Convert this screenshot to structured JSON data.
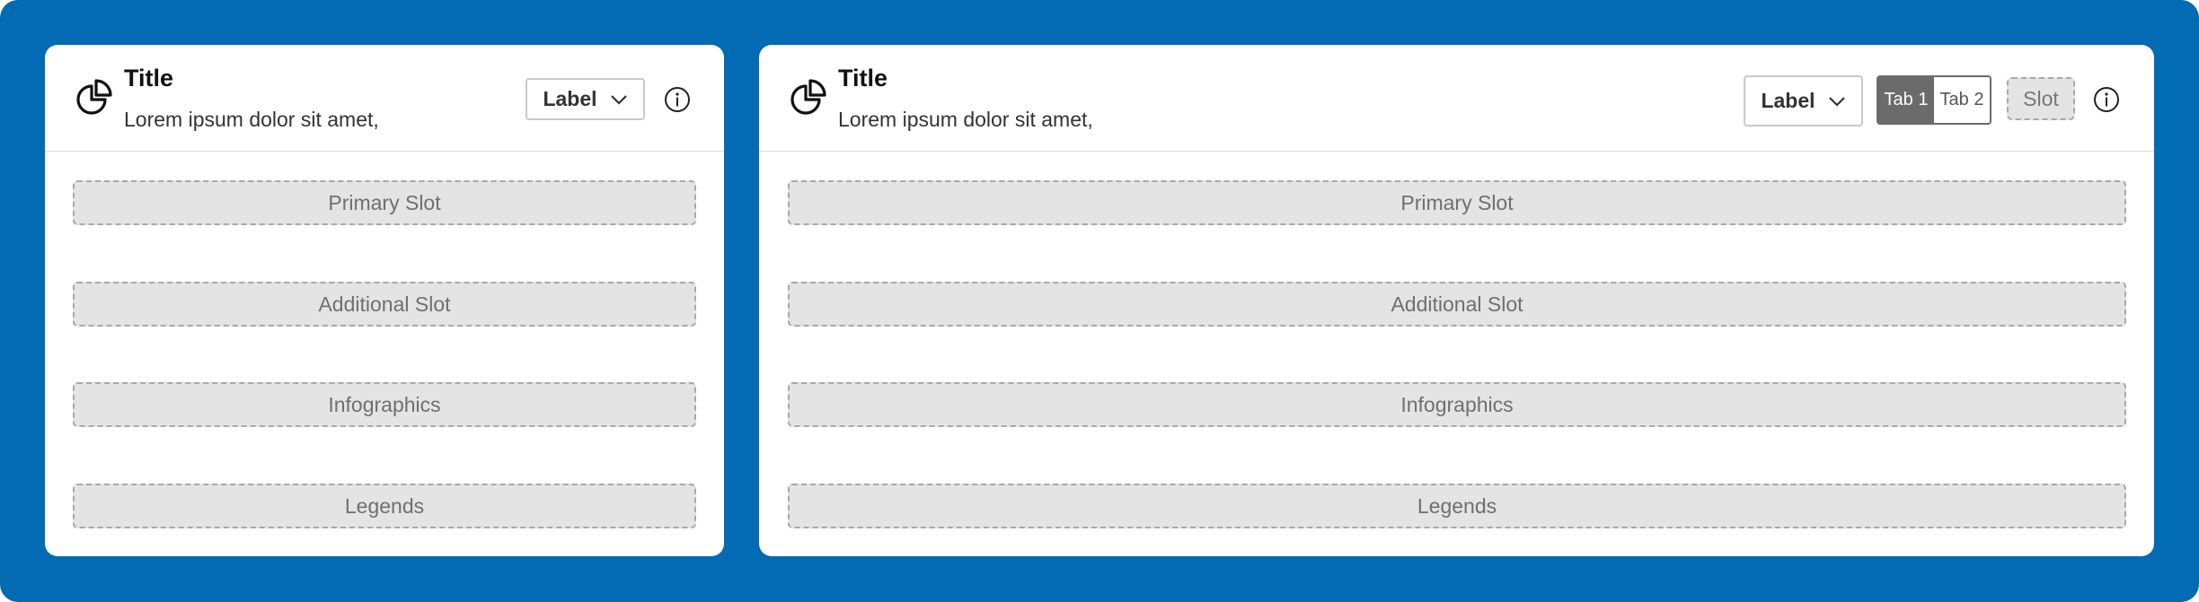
{
  "colors": {
    "background": "#036ab4",
    "card": "#ffffff",
    "slot_fill": "#e4e4e4",
    "tab_active": "#6b6b6b"
  },
  "card_compact": {
    "icon": "pie-chart-icon",
    "title": "Title",
    "subtitle": "Lorem ipsum dolor sit amet,",
    "dropdown_label": "Label",
    "info_icon": "info-icon",
    "slots": {
      "primary": "Primary Slot",
      "additional": "Additional Slot",
      "infographics": "Infographics",
      "legends": "Legends"
    }
  },
  "card_wide": {
    "icon": "pie-chart-icon",
    "title": "Title",
    "subtitle": "Lorem ipsum dolor sit amet,",
    "dropdown_label": "Label",
    "tabs": [
      {
        "label": "Tab 1",
        "active": true
      },
      {
        "label": "Tab 2",
        "active": false
      }
    ],
    "header_slot": "Slot",
    "info_icon": "info-icon",
    "slots": {
      "primary": "Primary Slot",
      "additional": "Additional Slot",
      "infographics": "Infographics",
      "legends": "Legends"
    }
  }
}
